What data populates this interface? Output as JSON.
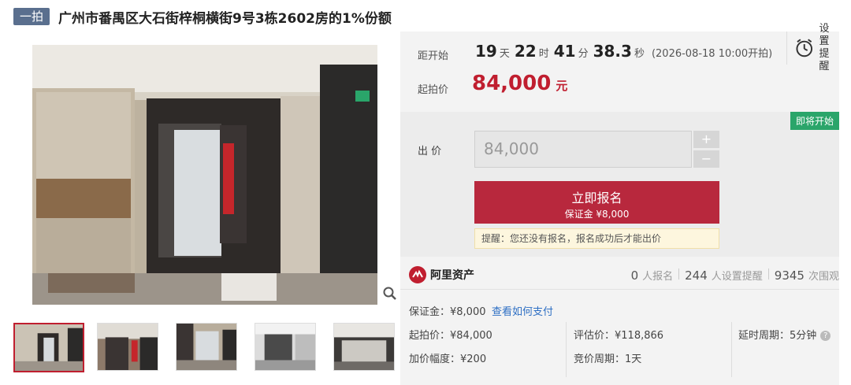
{
  "header": {
    "badge": "一拍",
    "title": "广州市番禺区大石街梓桐横街9号3栋2602房的1%份额"
  },
  "countdown": {
    "label": "距开始",
    "days": "19",
    "days_unit": "天",
    "hours": "22",
    "hours_unit": "时",
    "minutes": "41",
    "minutes_unit": "分",
    "seconds": "38.3",
    "seconds_unit": "秒",
    "start_note": "(2026-08-18 10:00开拍)"
  },
  "reminder": {
    "line1": "设置",
    "line2": "提醒",
    "icon": "alarm-clock-icon"
  },
  "start_price": {
    "label": "起拍价",
    "value": "84,000",
    "unit": "元"
  },
  "bid": {
    "status_tag": "即将开始",
    "label": "出 价",
    "input_value": "84,000",
    "plus": "+",
    "minus": "−",
    "signup_label": "立即报名",
    "deposit_note": "保证金 ¥8,000",
    "tip": "提醒：您还没有报名，报名成功后才能出价"
  },
  "platform": {
    "name": "阿里资产",
    "stats": [
      {
        "value": "0",
        "label": "人报名"
      },
      {
        "value": "244",
        "label": "人设置提醒"
      },
      {
        "value": "9345",
        "label": "次围观"
      }
    ]
  },
  "details": {
    "deposit": "保证金：¥8,000",
    "how_to_pay": "查看如何支付",
    "start_price": "起拍价：¥84,000",
    "appraisal": "评估价：¥118,866",
    "delay_period": "延时周期：5分钟",
    "increment": "加价幅度：¥200",
    "bidding_period": "竞价周期：1天"
  },
  "colors": {
    "accent": "#b8283d",
    "price": "#c01e2f",
    "tag": "#2aa56a",
    "badge": "#5a6f8e",
    "link": "#2e6fc4"
  }
}
